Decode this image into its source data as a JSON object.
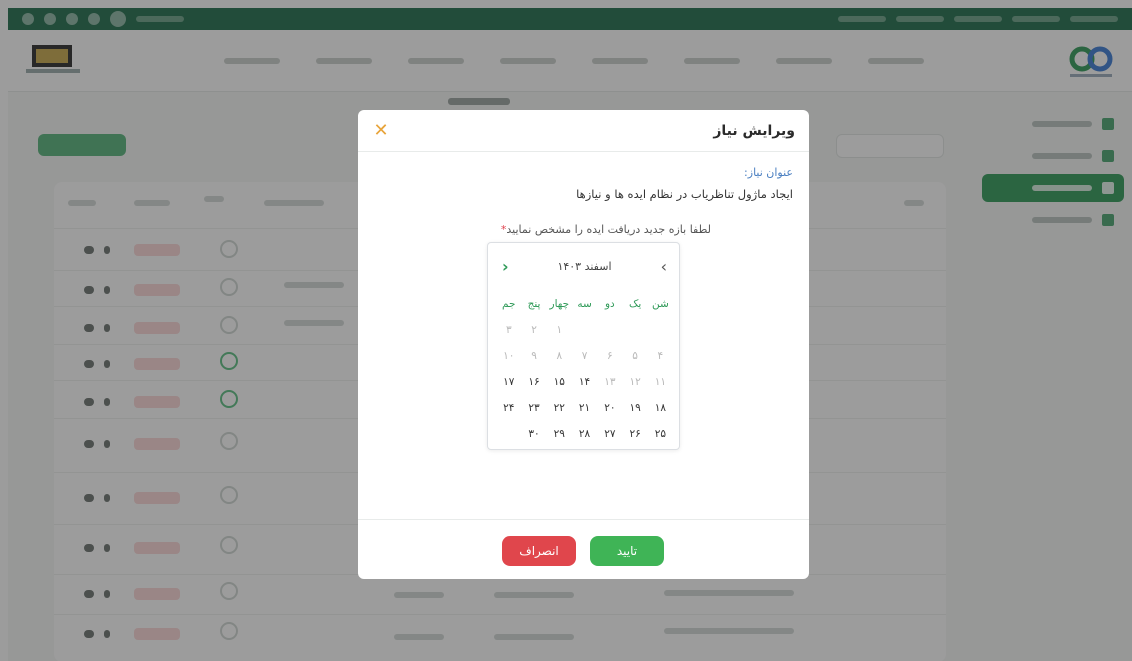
{
  "modal": {
    "title": "ویرایش نیاز",
    "close_icon": "close-icon",
    "need_title_label": "عنوان نیاز:",
    "need_title_value": "ایجاد ماژول تناظریاب در نظام ایده ها و نیازها",
    "range_prompt": "لطفا بازه جدید دریافت ایده را مشخص نمایید",
    "required_mark": "*",
    "confirm_label": "تایید",
    "cancel_label": "انصراف"
  },
  "calendar": {
    "month_label": "اسفند ۱۴۰۳",
    "prev_icon": "chevron-right-icon",
    "next_icon": "chevron-left-icon",
    "weekdays": [
      "شن",
      "یک",
      "دو",
      "سه",
      "چهار",
      "پنج",
      "جم"
    ],
    "weeks": [
      [
        "",
        "",
        "",
        "",
        "۱",
        "۲",
        "۳"
      ],
      [
        "۴",
        "۵",
        "۶",
        "۷",
        "۸",
        "۹",
        "۱۰"
      ],
      [
        "۱۱",
        "۱۲",
        "۱۳",
        "۱۴",
        "۱۵",
        "۱۶",
        "۱۷"
      ],
      [
        "۱۸",
        "۱۹",
        "۲۰",
        "۲۱",
        "۲۲",
        "۲۳",
        "۲۴"
      ],
      [
        "۲۵",
        "۲۶",
        "۲۷",
        "۲۸",
        "۲۹",
        "۳۰",
        ""
      ]
    ],
    "disabled_through_week": 1,
    "disabled_in_week_2": [
      "۱۱",
      "۱۲",
      "۱۳"
    ]
  },
  "colors": {
    "accent": "#2f9a58",
    "confirm": "#3fb456",
    "cancel": "#e0464c",
    "close": "#e8a43a",
    "label_blue": "#4a7fc1"
  }
}
